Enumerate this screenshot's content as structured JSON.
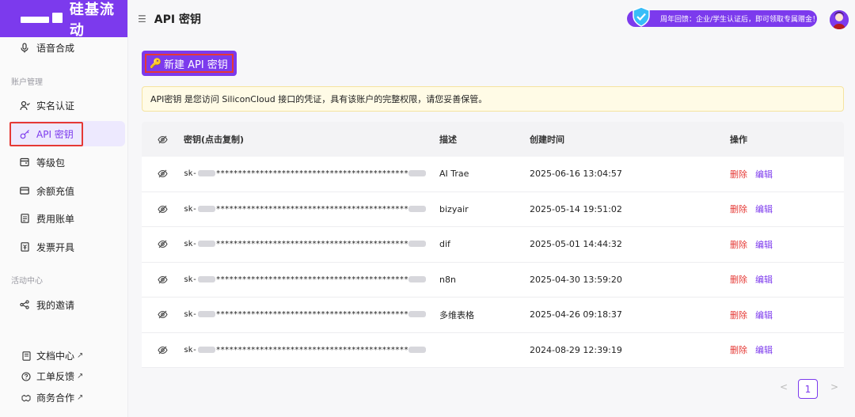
{
  "brand": {
    "name": "硅基流动"
  },
  "sidebar": {
    "top_item": {
      "label": "语音合成"
    },
    "section_account": "账户管理",
    "account_items": [
      {
        "label": "实名认证",
        "icon": "user-check-icon"
      },
      {
        "label": "API 密钥",
        "icon": "key-icon"
      },
      {
        "label": "等级包",
        "icon": "package-icon"
      },
      {
        "label": "余额充值",
        "icon": "card-icon"
      },
      {
        "label": "费用账单",
        "icon": "bill-icon"
      },
      {
        "label": "发票开具",
        "icon": "invoice-icon"
      }
    ],
    "section_activity": "活动中心",
    "activity_items": [
      {
        "label": "我的邀请",
        "icon": "share-icon"
      }
    ],
    "bottom_items": [
      {
        "label": "文档中心",
        "ext": "↗"
      },
      {
        "label": "工单反馈",
        "ext": "↗"
      },
      {
        "label": "商务合作",
        "ext": "↗"
      }
    ]
  },
  "header": {
    "title": "API 密钥",
    "promo": "周年回馈：企业/学生认证后，即可领取专属赠金！"
  },
  "main": {
    "new_key_button": "新建 API 密钥",
    "notice": "API密钥 是您访问 SiliconCloud 接口的凭证，具有该账户的完整权限，请您妥善保管。",
    "table": {
      "headers": [
        "密钥(点击复制)",
        "描述",
        "创建时间",
        "操作"
      ],
      "rows": [
        {
          "key_prefix": "sk-",
          "key_mask": "********************************************",
          "desc": "AI Trae",
          "created": "2025-06-16 13:04:57"
        },
        {
          "key_prefix": "sk-",
          "key_mask": "********************************************",
          "desc": "bizyair",
          "created": "2025-05-14 19:51:02"
        },
        {
          "key_prefix": "sk-",
          "key_mask": "********************************************",
          "desc": "dif",
          "created": "2025-05-01 14:44:32"
        },
        {
          "key_prefix": "sk-",
          "key_mask": "********************************************",
          "desc": "n8n",
          "created": "2025-04-30 13:59:20"
        },
        {
          "key_prefix": "sk-",
          "key_mask": "********************************************",
          "desc": "多维表格",
          "created": "2025-04-26 09:18:37"
        },
        {
          "key_prefix": "sk-",
          "key_mask": "********************************************",
          "desc": "",
          "created": "2024-08-29 12:39:19"
        }
      ],
      "action_delete": "删除",
      "action_edit": "编辑"
    },
    "pagination": {
      "prev": "<",
      "current": "1",
      "next": ">"
    }
  },
  "colors": {
    "accent": "#7c3aed",
    "danger": "#e53935",
    "notice_bg": "#fffbe6"
  }
}
